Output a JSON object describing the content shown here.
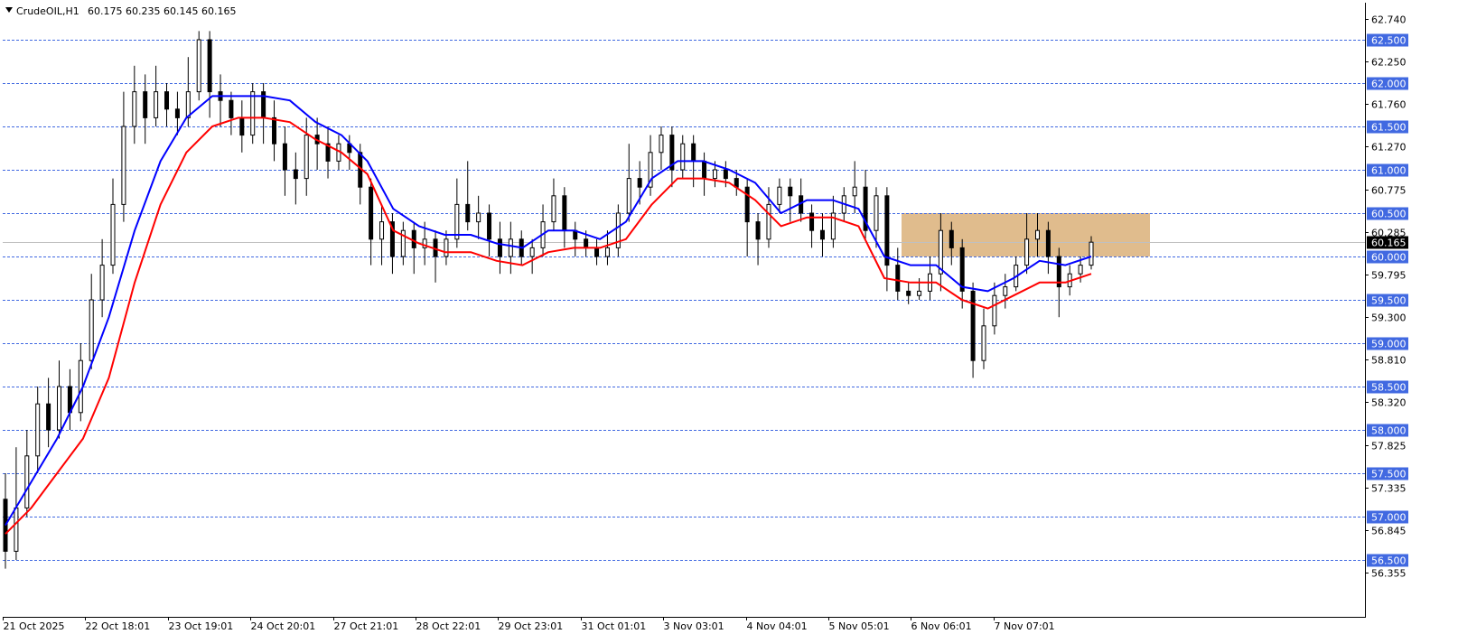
{
  "header": {
    "symbol_timeframe": "CrudeOIL,H1",
    "ohlc": "60.175 60.235 60.145 60.165"
  },
  "colors": {
    "ema_fast": "#0000ff",
    "ema_slow": "#ff0000",
    "candle": "#000000",
    "zone": "#deb887",
    "level_line": "#4169e1",
    "level_label_bg": "#4169e1",
    "current_price_bg": "#000000"
  },
  "chart_data": {
    "type": "line",
    "ylim": [
      56.2,
      62.85
    ],
    "grid": false,
    "current_price": "60.165",
    "y_ticks": [
      "62.740",
      "62.250",
      "61.760",
      "61.270",
      "60.775",
      "60.285",
      "59.795",
      "59.300",
      "58.810",
      "58.320",
      "57.825",
      "57.335",
      "56.845",
      "56.355"
    ],
    "levels": [
      "62.500",
      "62.000",
      "61.500",
      "61.000",
      "60.500",
      "60.000",
      "59.500",
      "59.000",
      "58.500",
      "58.000",
      "57.500",
      "57.000",
      "56.500"
    ],
    "x_tick_labels": [
      "21 Oct 2025",
      "22 Oct 18:01",
      "23 Oct 19:01",
      "24 Oct 20:01",
      "27 Oct 21:01",
      "28 Oct 22:01",
      "29 Oct 23:01",
      "31 Oct 01:01",
      "3 Nov 03:01",
      "4 Nov 04:01",
      "5 Nov 05:01",
      "6 Nov 06:01",
      "7 Nov 07:01"
    ],
    "zone": {
      "from": 60.0,
      "to": 60.5
    },
    "series": [
      {
        "values": [
          56.9,
          57.4,
          57.9,
          58.5,
          59.3,
          60.3,
          61.1,
          61.6,
          61.85,
          61.85,
          61.85,
          61.8,
          61.55,
          61.4,
          61.1,
          60.55,
          60.35,
          60.25,
          60.25,
          60.15,
          60.1,
          60.3,
          60.3,
          60.2,
          60.4,
          60.9,
          61.1,
          61.1,
          61.0,
          60.85,
          60.5,
          60.65,
          60.65,
          60.55,
          60.0,
          59.9,
          59.9,
          59.65,
          59.6,
          59.75,
          59.95,
          59.9,
          60.0
        ]
      },
      {
        "values": [
          56.8,
          57.1,
          57.5,
          57.9,
          58.6,
          59.7,
          60.6,
          61.2,
          61.5,
          61.6,
          61.6,
          61.55,
          61.35,
          61.2,
          60.95,
          60.3,
          60.15,
          60.05,
          60.05,
          59.95,
          59.9,
          60.05,
          60.1,
          60.1,
          60.2,
          60.6,
          60.9,
          60.9,
          60.85,
          60.65,
          60.35,
          60.45,
          60.45,
          60.35,
          59.75,
          59.7,
          59.7,
          59.5,
          59.4,
          59.55,
          59.7,
          59.7,
          59.8
        ]
      }
    ],
    "candles": [
      [
        57.2,
        56.6,
        57.5,
        56.4
      ],
      [
        56.6,
        57.1,
        57.8,
        56.5
      ],
      [
        57.1,
        57.7,
        58.0,
        57.0
      ],
      [
        57.7,
        58.3,
        58.5,
        57.5
      ],
      [
        58.3,
        58.0,
        58.6,
        57.8
      ],
      [
        58.0,
        58.5,
        58.8,
        57.9
      ],
      [
        58.5,
        58.2,
        58.7,
        58.0
      ],
      [
        58.2,
        58.8,
        59.0,
        58.1
      ],
      [
        58.8,
        59.5,
        59.8,
        58.7
      ],
      [
        59.5,
        59.9,
        60.2,
        59.3
      ],
      [
        59.9,
        60.6,
        60.9,
        59.8
      ],
      [
        60.6,
        61.5,
        61.9,
        60.4
      ],
      [
        61.5,
        61.9,
        62.2,
        61.3
      ],
      [
        61.9,
        61.6,
        62.1,
        61.3
      ],
      [
        61.6,
        61.9,
        62.2,
        61.5
      ],
      [
        61.9,
        61.7,
        62.0,
        61.5
      ],
      [
        61.7,
        61.6,
        61.9,
        61.4
      ],
      [
        61.6,
        61.9,
        62.3,
        61.5
      ],
      [
        61.9,
        62.5,
        62.6,
        61.8
      ],
      [
        62.5,
        61.9,
        62.6,
        61.6
      ],
      [
        61.9,
        61.8,
        62.1,
        61.5
      ],
      [
        61.8,
        61.6,
        61.9,
        61.4
      ],
      [
        61.6,
        61.4,
        61.8,
        61.2
      ],
      [
        61.4,
        61.9,
        62.0,
        61.3
      ],
      [
        61.9,
        61.6,
        62.0,
        61.3
      ],
      [
        61.6,
        61.3,
        61.8,
        61.1
      ],
      [
        61.3,
        61.0,
        61.5,
        60.7
      ],
      [
        61.0,
        60.9,
        61.2,
        60.6
      ],
      [
        60.9,
        61.4,
        61.6,
        60.7
      ],
      [
        61.4,
        61.3,
        61.6,
        61.0
      ],
      [
        61.3,
        61.1,
        61.5,
        60.9
      ],
      [
        61.1,
        61.3,
        61.4,
        61.0
      ],
      [
        61.3,
        61.2,
        61.4,
        61.0
      ],
      [
        61.2,
        60.8,
        61.3,
        60.6
      ],
      [
        60.8,
        60.2,
        60.9,
        59.9
      ],
      [
        60.2,
        60.4,
        60.6,
        59.9
      ],
      [
        60.4,
        60.0,
        60.5,
        59.8
      ],
      [
        60.0,
        60.3,
        60.4,
        59.9
      ],
      [
        60.3,
        60.1,
        60.4,
        59.8
      ],
      [
        60.1,
        60.2,
        60.4,
        59.9
      ],
      [
        60.2,
        60.0,
        60.3,
        59.7
      ],
      [
        60.0,
        60.2,
        60.3,
        59.9
      ],
      [
        60.2,
        60.6,
        60.9,
        60.1
      ],
      [
        60.6,
        60.4,
        61.1,
        60.3
      ],
      [
        60.4,
        60.5,
        60.7,
        60.2
      ],
      [
        60.5,
        60.2,
        60.6,
        60.0
      ],
      [
        60.2,
        60.0,
        60.4,
        59.8
      ],
      [
        60.0,
        60.2,
        60.4,
        59.8
      ],
      [
        60.2,
        60.0,
        60.3,
        59.9
      ],
      [
        60.0,
        60.1,
        60.2,
        59.8
      ],
      [
        60.1,
        60.4,
        60.6,
        60.0
      ],
      [
        60.4,
        60.7,
        60.9,
        60.3
      ],
      [
        60.7,
        60.3,
        60.8,
        60.1
      ],
      [
        60.3,
        60.2,
        60.4,
        60.0
      ],
      [
        60.2,
        60.1,
        60.3,
        60.0
      ],
      [
        60.1,
        60.0,
        60.2,
        59.9
      ],
      [
        60.0,
        60.1,
        60.3,
        59.9
      ],
      [
        60.1,
        60.5,
        60.6,
        60.0
      ],
      [
        60.5,
        60.9,
        61.3,
        60.4
      ],
      [
        60.9,
        60.8,
        61.1,
        60.6
      ],
      [
        60.8,
        61.2,
        61.4,
        60.7
      ],
      [
        61.2,
        61.4,
        61.5,
        61.0
      ],
      [
        61.4,
        61.0,
        61.5,
        60.8
      ],
      [
        61.0,
        61.3,
        61.4,
        60.9
      ],
      [
        61.3,
        61.1,
        61.4,
        60.8
      ],
      [
        61.1,
        60.9,
        61.2,
        60.7
      ],
      [
        60.9,
        61.0,
        61.1,
        60.8
      ],
      [
        61.0,
        60.9,
        61.1,
        60.8
      ],
      [
        60.9,
        60.8,
        61.0,
        60.7
      ],
      [
        60.8,
        60.4,
        60.9,
        60.0
      ],
      [
        60.4,
        60.2,
        60.5,
        59.9
      ],
      [
        60.2,
        60.6,
        60.8,
        60.1
      ],
      [
        60.6,
        60.8,
        60.9,
        60.5
      ],
      [
        60.8,
        60.7,
        60.9,
        60.4
      ],
      [
        60.7,
        60.5,
        60.9,
        60.4
      ],
      [
        60.5,
        60.3,
        60.6,
        60.1
      ],
      [
        60.3,
        60.2,
        60.5,
        60.0
      ],
      [
        60.2,
        60.5,
        60.7,
        60.1
      ],
      [
        60.5,
        60.7,
        60.8,
        60.4
      ],
      [
        60.7,
        60.8,
        61.1,
        60.5
      ],
      [
        60.8,
        60.3,
        61.0,
        60.2
      ],
      [
        60.3,
        60.7,
        60.8,
        60.1
      ],
      [
        60.7,
        59.9,
        60.8,
        59.6
      ],
      [
        59.9,
        59.6,
        60.1,
        59.5
      ],
      [
        59.6,
        59.55,
        59.7,
        59.45
      ],
      [
        59.55,
        59.6,
        59.75,
        59.5
      ],
      [
        59.6,
        59.8,
        60.0,
        59.5
      ],
      [
        59.8,
        60.3,
        60.5,
        59.6
      ],
      [
        60.3,
        60.1,
        60.4,
        59.9
      ],
      [
        60.1,
        59.6,
        60.2,
        59.4
      ],
      [
        59.6,
        58.8,
        59.7,
        58.6
      ],
      [
        58.8,
        59.2,
        59.4,
        58.7
      ],
      [
        59.2,
        59.55,
        59.7,
        59.1
      ],
      [
        59.55,
        59.65,
        59.8,
        59.4
      ],
      [
        59.65,
        59.9,
        60.0,
        59.6
      ],
      [
        59.9,
        60.2,
        60.5,
        59.8
      ],
      [
        60.2,
        60.3,
        60.5,
        60.0
      ],
      [
        60.3,
        60.0,
        60.4,
        59.8
      ],
      [
        60.0,
        59.65,
        60.1,
        59.3
      ],
      [
        59.65,
        59.8,
        59.9,
        59.55
      ],
      [
        59.8,
        59.9,
        60.0,
        59.7
      ],
      [
        59.9,
        60.165,
        60.235,
        59.85
      ]
    ]
  }
}
